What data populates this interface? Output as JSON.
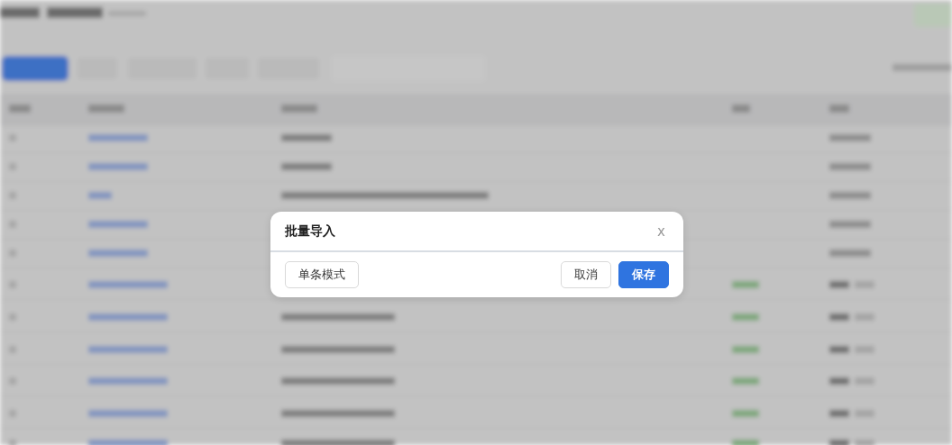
{
  "dialog": {
    "title": "批量导入",
    "close": "x",
    "buttons": [
      {
        "label": "单条模式",
        "kind": "secondary"
      },
      {
        "label": "取消",
        "kind": "secondary"
      },
      {
        "label": "保存",
        "kind": "primary"
      }
    ]
  }
}
